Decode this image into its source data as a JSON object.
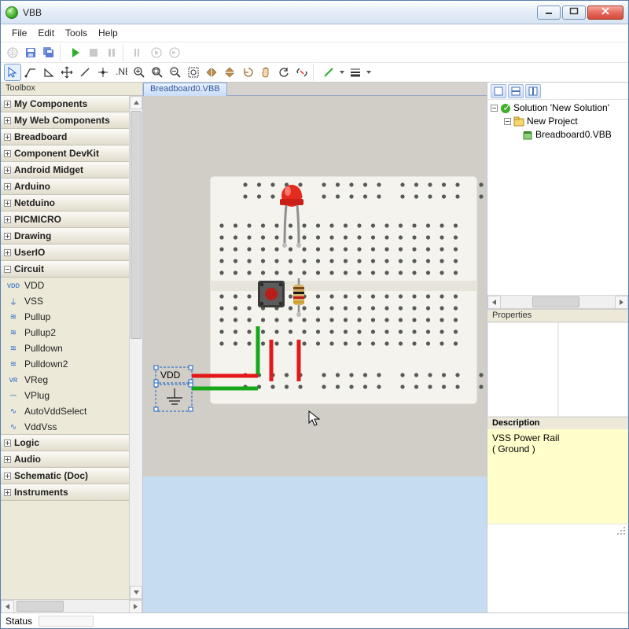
{
  "window": {
    "title": "VBB"
  },
  "menu": {
    "file": "File",
    "edit": "Edit",
    "tools": "Tools",
    "help": "Help"
  },
  "toolbox": {
    "title": "Toolbox",
    "categories": [
      {
        "name": "My Components",
        "expanded": false
      },
      {
        "name": "My Web Components",
        "expanded": false
      },
      {
        "name": "Breadboard",
        "expanded": false
      },
      {
        "name": "Component DevKit",
        "expanded": false
      },
      {
        "name": "Android Midget",
        "expanded": false
      },
      {
        "name": "Arduino",
        "expanded": false
      },
      {
        "name": "Netduino",
        "expanded": false
      },
      {
        "name": "PICMICRO",
        "expanded": false
      },
      {
        "name": "Drawing",
        "expanded": false
      },
      {
        "name": "UserIO",
        "expanded": false
      },
      {
        "name": "Circuit",
        "expanded": true,
        "items": [
          "VDD",
          "VSS",
          "Pullup",
          "Pullup2",
          "Pulldown",
          "Pulldown2",
          "VReg",
          "VPlug",
          "AutoVddSelect",
          "VddVss"
        ]
      },
      {
        "name": "Logic",
        "expanded": false
      },
      {
        "name": "Audio",
        "expanded": false
      },
      {
        "name": "Schematic (Doc)",
        "expanded": false
      },
      {
        "name": "Instruments",
        "expanded": false
      }
    ]
  },
  "tabs": {
    "active": "Breadboard0.VBB"
  },
  "solution": {
    "root": "Solution 'New Solution'",
    "project": "New Project",
    "file": "Breadboard0.VBB"
  },
  "properties": {
    "title": "Properties"
  },
  "description": {
    "title": "Description",
    "line1": "VSS Power Rail",
    "line2": "( Ground )"
  },
  "status": {
    "label": "Status"
  },
  "labels": {
    "vdd": "VDD"
  }
}
